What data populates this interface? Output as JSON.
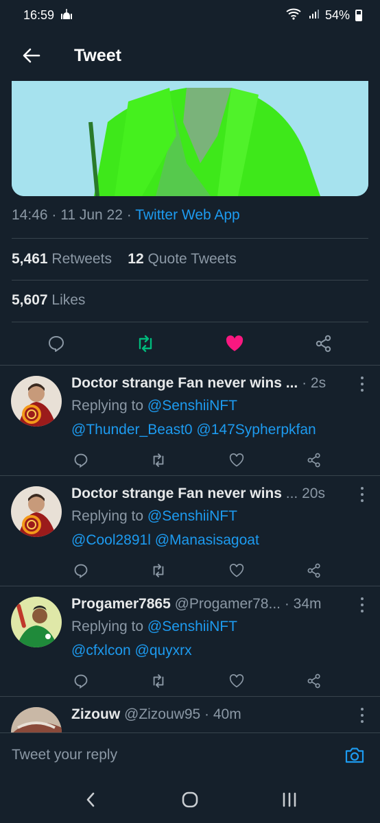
{
  "status_bar": {
    "time": "16:59",
    "battery": "54%"
  },
  "header": {
    "title": "Tweet"
  },
  "tweet": {
    "time": "14:46",
    "date": "11 Jun 22",
    "app": "Twitter Web App",
    "retweets_count": "5,461",
    "retweets_label": "Retweets",
    "quotes_count": "12",
    "quotes_label": "Quote Tweets",
    "likes_count": "5,607",
    "likes_label": "Likes"
  },
  "replies": [
    {
      "name": "Doctor strange Fan never wins ...",
      "handle": "",
      "time": "2s",
      "replying_to_label": "Replying to",
      "replying_to": "@SenshiiNFT",
      "mentions": "@Thunder_Beast0 @147Sypherpkfan"
    },
    {
      "name": "Doctor strange Fan never wins",
      "handle": "...",
      "time": "20s",
      "replying_to_label": "Replying to",
      "replying_to": "@SenshiiNFT",
      "mentions": "@Cool2891l @Manasisagoat"
    },
    {
      "name": "Progamer7865",
      "handle": "@Progamer78...",
      "time": "34m",
      "replying_to_label": "Replying to",
      "replying_to": "@SenshiiNFT",
      "mentions": "@cfxlcon @quyxrx"
    },
    {
      "name": "Zizouw",
      "handle": "@Zizouw95",
      "time": "40m"
    }
  ],
  "composer": {
    "placeholder": "Tweet your reply"
  },
  "colors": {
    "accent": "#1d9bf0",
    "retweet": "#00ba7c",
    "like": "#f91880",
    "background": "#15202b"
  }
}
